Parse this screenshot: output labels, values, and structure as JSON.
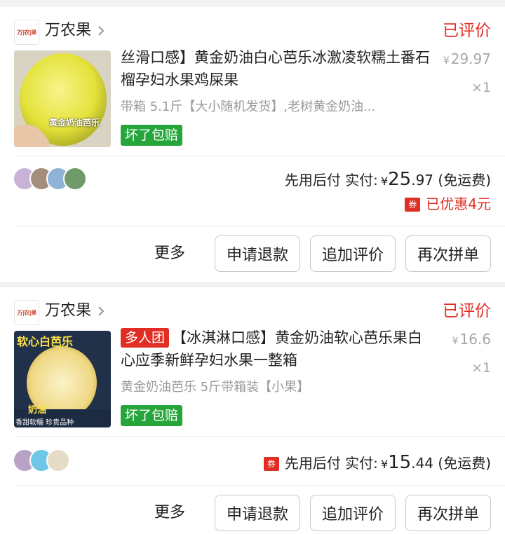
{
  "orders": [
    {
      "shop": {
        "name": "万农果",
        "logo_text": "万|农|果"
      },
      "status": "已评价",
      "product": {
        "tag": "",
        "title": "丝滑口感】黄金奶油白心芭乐冰激凌软糯土番石榴孕妇水果鸡屎果",
        "spec": "带箱 5.1斤【大小随机发货】,老树黄金奶油...",
        "badge": "坏了包赔",
        "image_caption": "黄金奶油芭乐",
        "orig_price_symbol": "¥",
        "orig_price": "29.97",
        "quantity": "×1"
      },
      "payment": {
        "label": "先用后付 实付:",
        "currency": "¥",
        "amount_int": "25",
        "amount_dec": ".97",
        "shipping": "(免运费)",
        "coupon_icon": "券",
        "discount": "已优惠4元"
      },
      "actions": {
        "more": "更多",
        "refund": "申请退款",
        "add_review": "追加评价",
        "reorder": "再次拼单"
      }
    },
    {
      "shop": {
        "name": "万农果",
        "logo_text": "万|农|果"
      },
      "status": "已评价",
      "product": {
        "tag": "多人团",
        "title": "【冰淇淋口感】黄金奶油软心芭乐果白心应季新鲜孕妇水果一整箱",
        "spec": "黄金奶油芭乐 5斤带箱装【小果】",
        "badge": "坏了包赔",
        "image_caption": "软心白芭乐",
        "image_sub_caption": "奶油",
        "image_caption_2": "香甜软糯 珍贵品种",
        "orig_price_symbol": "¥",
        "orig_price": "16.6",
        "quantity": "×1"
      },
      "payment": {
        "label": "先用后付 实付:",
        "currency": "¥",
        "amount_int": "15",
        "amount_dec": ".44",
        "shipping": "(免运费)",
        "coupon_icon": "券"
      },
      "actions": {
        "more": "更多",
        "refund": "申请退款",
        "add_review": "追加评价",
        "reorder": "再次拼单"
      }
    }
  ],
  "colors": {
    "accent": "#e02e24",
    "badge_green": "#25a53a",
    "muted": "#9a9a9a"
  }
}
